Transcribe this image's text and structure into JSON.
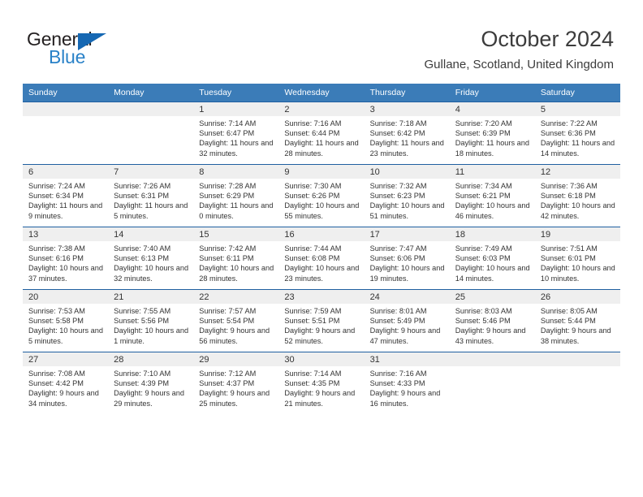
{
  "brand": {
    "name_part1": "General",
    "name_part2": "Blue",
    "triangle_color": "#1668b3",
    "blue_text_color": "#2a82c8"
  },
  "header": {
    "title": "October 2024",
    "subtitle": "Gullane, Scotland, United Kingdom"
  },
  "theme": {
    "header_row_bg": "#3b7cb8",
    "week_divider": "#1f5fa0",
    "daynum_band_bg": "#efefef",
    "text_color": "#333333"
  },
  "weekday_headers": [
    "Sunday",
    "Monday",
    "Tuesday",
    "Wednesday",
    "Thursday",
    "Friday",
    "Saturday"
  ],
  "labels": {
    "sunrise_prefix": "Sunrise:",
    "sunset_prefix": "Sunset:",
    "daylight_prefix": "Daylight:"
  },
  "weeks": [
    [
      {
        "day": "",
        "empty": true
      },
      {
        "day": "",
        "empty": true
      },
      {
        "day": "1",
        "sunrise": "Sunrise: 7:14 AM",
        "sunset": "Sunset: 6:47 PM",
        "daylight": "Daylight: 11 hours and 32 minutes."
      },
      {
        "day": "2",
        "sunrise": "Sunrise: 7:16 AM",
        "sunset": "Sunset: 6:44 PM",
        "daylight": "Daylight: 11 hours and 28 minutes."
      },
      {
        "day": "3",
        "sunrise": "Sunrise: 7:18 AM",
        "sunset": "Sunset: 6:42 PM",
        "daylight": "Daylight: 11 hours and 23 minutes."
      },
      {
        "day": "4",
        "sunrise": "Sunrise: 7:20 AM",
        "sunset": "Sunset: 6:39 PM",
        "daylight": "Daylight: 11 hours and 18 minutes."
      },
      {
        "day": "5",
        "sunrise": "Sunrise: 7:22 AM",
        "sunset": "Sunset: 6:36 PM",
        "daylight": "Daylight: 11 hours and 14 minutes."
      }
    ],
    [
      {
        "day": "6",
        "sunrise": "Sunrise: 7:24 AM",
        "sunset": "Sunset: 6:34 PM",
        "daylight": "Daylight: 11 hours and 9 minutes."
      },
      {
        "day": "7",
        "sunrise": "Sunrise: 7:26 AM",
        "sunset": "Sunset: 6:31 PM",
        "daylight": "Daylight: 11 hours and 5 minutes."
      },
      {
        "day": "8",
        "sunrise": "Sunrise: 7:28 AM",
        "sunset": "Sunset: 6:29 PM",
        "daylight": "Daylight: 11 hours and 0 minutes."
      },
      {
        "day": "9",
        "sunrise": "Sunrise: 7:30 AM",
        "sunset": "Sunset: 6:26 PM",
        "daylight": "Daylight: 10 hours and 55 minutes."
      },
      {
        "day": "10",
        "sunrise": "Sunrise: 7:32 AM",
        "sunset": "Sunset: 6:23 PM",
        "daylight": "Daylight: 10 hours and 51 minutes."
      },
      {
        "day": "11",
        "sunrise": "Sunrise: 7:34 AM",
        "sunset": "Sunset: 6:21 PM",
        "daylight": "Daylight: 10 hours and 46 minutes."
      },
      {
        "day": "12",
        "sunrise": "Sunrise: 7:36 AM",
        "sunset": "Sunset: 6:18 PM",
        "daylight": "Daylight: 10 hours and 42 minutes."
      }
    ],
    [
      {
        "day": "13",
        "sunrise": "Sunrise: 7:38 AM",
        "sunset": "Sunset: 6:16 PM",
        "daylight": "Daylight: 10 hours and 37 minutes."
      },
      {
        "day": "14",
        "sunrise": "Sunrise: 7:40 AM",
        "sunset": "Sunset: 6:13 PM",
        "daylight": "Daylight: 10 hours and 32 minutes."
      },
      {
        "day": "15",
        "sunrise": "Sunrise: 7:42 AM",
        "sunset": "Sunset: 6:11 PM",
        "daylight": "Daylight: 10 hours and 28 minutes."
      },
      {
        "day": "16",
        "sunrise": "Sunrise: 7:44 AM",
        "sunset": "Sunset: 6:08 PM",
        "daylight": "Daylight: 10 hours and 23 minutes."
      },
      {
        "day": "17",
        "sunrise": "Sunrise: 7:47 AM",
        "sunset": "Sunset: 6:06 PM",
        "daylight": "Daylight: 10 hours and 19 minutes."
      },
      {
        "day": "18",
        "sunrise": "Sunrise: 7:49 AM",
        "sunset": "Sunset: 6:03 PM",
        "daylight": "Daylight: 10 hours and 14 minutes."
      },
      {
        "day": "19",
        "sunrise": "Sunrise: 7:51 AM",
        "sunset": "Sunset: 6:01 PM",
        "daylight": "Daylight: 10 hours and 10 minutes."
      }
    ],
    [
      {
        "day": "20",
        "sunrise": "Sunrise: 7:53 AM",
        "sunset": "Sunset: 5:58 PM",
        "daylight": "Daylight: 10 hours and 5 minutes."
      },
      {
        "day": "21",
        "sunrise": "Sunrise: 7:55 AM",
        "sunset": "Sunset: 5:56 PM",
        "daylight": "Daylight: 10 hours and 1 minute."
      },
      {
        "day": "22",
        "sunrise": "Sunrise: 7:57 AM",
        "sunset": "Sunset: 5:54 PM",
        "daylight": "Daylight: 9 hours and 56 minutes."
      },
      {
        "day": "23",
        "sunrise": "Sunrise: 7:59 AM",
        "sunset": "Sunset: 5:51 PM",
        "daylight": "Daylight: 9 hours and 52 minutes."
      },
      {
        "day": "24",
        "sunrise": "Sunrise: 8:01 AM",
        "sunset": "Sunset: 5:49 PM",
        "daylight": "Daylight: 9 hours and 47 minutes."
      },
      {
        "day": "25",
        "sunrise": "Sunrise: 8:03 AM",
        "sunset": "Sunset: 5:46 PM",
        "daylight": "Daylight: 9 hours and 43 minutes."
      },
      {
        "day": "26",
        "sunrise": "Sunrise: 8:05 AM",
        "sunset": "Sunset: 5:44 PM",
        "daylight": "Daylight: 9 hours and 38 minutes."
      }
    ],
    [
      {
        "day": "27",
        "sunrise": "Sunrise: 7:08 AM",
        "sunset": "Sunset: 4:42 PM",
        "daylight": "Daylight: 9 hours and 34 minutes."
      },
      {
        "day": "28",
        "sunrise": "Sunrise: 7:10 AM",
        "sunset": "Sunset: 4:39 PM",
        "daylight": "Daylight: 9 hours and 29 minutes."
      },
      {
        "day": "29",
        "sunrise": "Sunrise: 7:12 AM",
        "sunset": "Sunset: 4:37 PM",
        "daylight": "Daylight: 9 hours and 25 minutes."
      },
      {
        "day": "30",
        "sunrise": "Sunrise: 7:14 AM",
        "sunset": "Sunset: 4:35 PM",
        "daylight": "Daylight: 9 hours and 21 minutes."
      },
      {
        "day": "31",
        "sunrise": "Sunrise: 7:16 AM",
        "sunset": "Sunset: 4:33 PM",
        "daylight": "Daylight: 9 hours and 16 minutes."
      },
      {
        "day": "",
        "empty": true
      },
      {
        "day": "",
        "empty": true
      }
    ]
  ]
}
